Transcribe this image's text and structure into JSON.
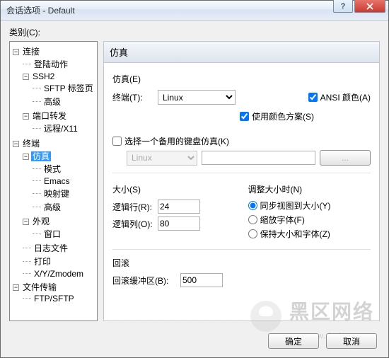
{
  "window": {
    "title": "会话选项 - Default"
  },
  "category_label": "类别(C):",
  "tree": {
    "connection": "连接",
    "login": "登陆动作",
    "ssh2": "SSH2",
    "sftp_tab": "SFTP 标签页",
    "advanced1": "高级",
    "port_fwd": "端口转发",
    "remote_x11": "远程/X11",
    "terminal": "终端",
    "emulation": "仿真",
    "mode": "模式",
    "emacs": "Emacs",
    "mapkey": "映射键",
    "advanced2": "高级",
    "appearance": "外观",
    "window_item": "窗口",
    "logfile": "日志文件",
    "print": "打印",
    "xyz": "X/Y/Zmodem",
    "filetrans": "文件传输",
    "ftpsftp": "FTP/SFTP"
  },
  "panel": {
    "header": "仿真",
    "emulation_group": "仿真(E)",
    "terminal_label": "终端(T):",
    "terminal_value": "Linux",
    "ansi_color": "ANSI 颜色(A)",
    "use_color_scheme": "使用颜色方案(S)",
    "alt_kb": "选择一个备用的键盘仿真(K)",
    "kb_value": "Linux",
    "ellipsis": "...",
    "size_group": "大小(S)",
    "rows_label": "逻辑行(R):",
    "rows_value": "24",
    "cols_label": "逻辑列(O):",
    "cols_value": "80",
    "resize_group": "调整大小时(N)",
    "radio_sync": "同步视图到大小(Y)",
    "radio_scale": "缩放字体(F)",
    "radio_keep": "保持大小和字体(Z)",
    "scrollback_group": "回滚",
    "scrollback_label": "回滚缓冲区(B):",
    "scrollback_value": "500"
  },
  "buttons": {
    "ok": "确定",
    "cancel": "取消"
  },
  "watermark": {
    "big": "黑区网络",
    "small": "www. heiqu. com"
  }
}
